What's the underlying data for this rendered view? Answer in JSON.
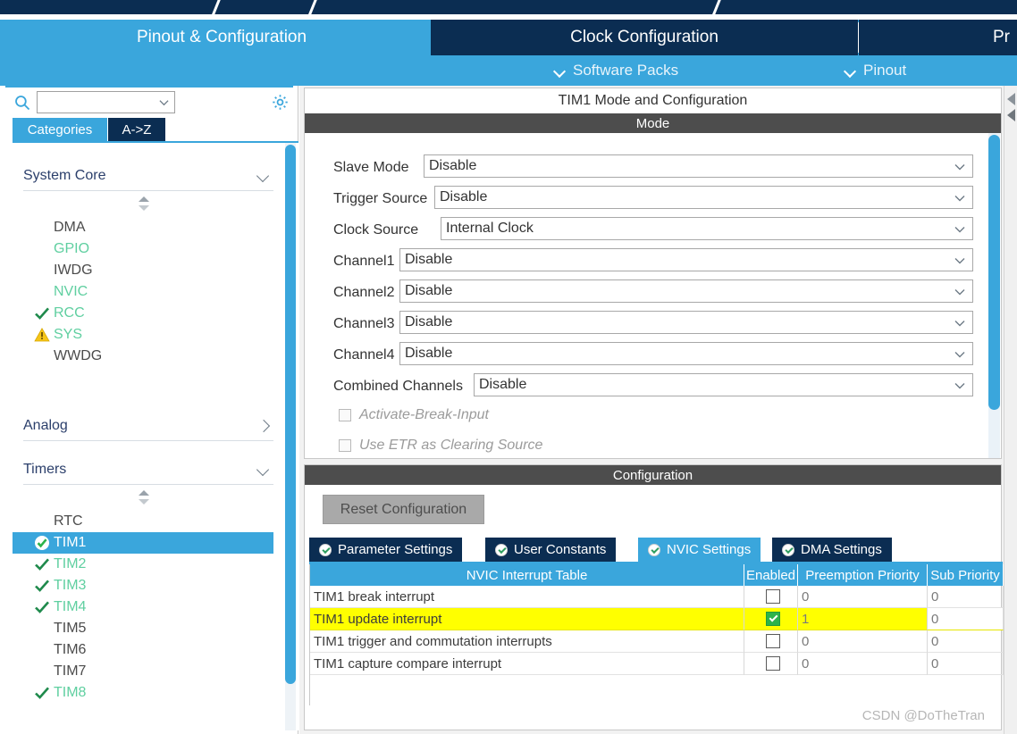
{
  "window": {
    "title_strip_color": "#0b2d52",
    "accent_color": "#3aa6dc",
    "navy_color": "#0b2d52"
  },
  "main_tabs": [
    {
      "label": "Pinout & Configuration",
      "active": true
    },
    {
      "label": "Clock Configuration",
      "active": false
    },
    {
      "label": "Pr",
      "active": false
    }
  ],
  "sub_tabs": [
    {
      "label": "Software Packs",
      "icon": "chevron-down-icon"
    },
    {
      "label": "Pinout",
      "icon": "chevron-down-icon"
    }
  ],
  "sidebar": {
    "search": {
      "value": "",
      "placeholder": "",
      "icon": "search-icon"
    },
    "settings_icon": "gear-icon",
    "filter_tabs": [
      {
        "label": "Categories",
        "selected": true
      },
      {
        "label": "A->Z",
        "selected": false
      }
    ],
    "groups": [
      {
        "name": "System Core",
        "expanded": true,
        "chevron": "chevron-down-icon",
        "items": [
          {
            "label": "DMA",
            "state": "none",
            "color": "#4b4b4b"
          },
          {
            "label": "GPIO",
            "state": "none",
            "color": "#5fcfa0"
          },
          {
            "label": "IWDG",
            "state": "none",
            "color": "#4b4b4b"
          },
          {
            "label": "NVIC",
            "state": "none",
            "color": "#5fcfa0"
          },
          {
            "label": "RCC",
            "state": "check",
            "color": "#5fcfa0"
          },
          {
            "label": "SYS",
            "state": "warning",
            "color": "#5fcfa0"
          },
          {
            "label": "WWDG",
            "state": "none",
            "color": "#4b4b4b"
          }
        ]
      },
      {
        "name": "Analog",
        "expanded": false,
        "chevron": "chevron-right-icon",
        "items": []
      },
      {
        "name": "Timers",
        "expanded": true,
        "chevron": "chevron-down-icon",
        "items": [
          {
            "label": "RTC",
            "state": "none",
            "color": "#4b4b4b",
            "selected": false
          },
          {
            "label": "TIM1",
            "state": "check-filled",
            "color": "#ffffff",
            "selected": true
          },
          {
            "label": "TIM2",
            "state": "check",
            "color": "#5fcfa0",
            "selected": false
          },
          {
            "label": "TIM3",
            "state": "check",
            "color": "#5fcfa0",
            "selected": false
          },
          {
            "label": "TIM4",
            "state": "check",
            "color": "#5fcfa0",
            "selected": false
          },
          {
            "label": "TIM5",
            "state": "none",
            "color": "#4b4b4b",
            "selected": false
          },
          {
            "label": "TIM6",
            "state": "none",
            "color": "#4b4b4b",
            "selected": false
          },
          {
            "label": "TIM7",
            "state": "none",
            "color": "#4b4b4b",
            "selected": false
          },
          {
            "label": "TIM8",
            "state": "check",
            "color": "#5fcfa0",
            "selected": false
          }
        ]
      }
    ]
  },
  "peripheral": {
    "title": "TIM1 Mode and Configuration",
    "mode_band": "Mode",
    "config_band": "Configuration",
    "mode_fields": [
      {
        "label": "Slave Mode",
        "value": "Disable"
      },
      {
        "label": "Trigger Source",
        "value": "Disable"
      },
      {
        "label": "Clock Source",
        "value": "Internal Clock"
      },
      {
        "label": "Channel1",
        "value": "Disable"
      },
      {
        "label": "Channel2",
        "value": "Disable"
      },
      {
        "label": "Channel3",
        "value": "Disable"
      },
      {
        "label": "Channel4",
        "value": "Disable"
      },
      {
        "label": "Combined Channels",
        "value": "Disable"
      }
    ],
    "mode_checkboxes": [
      {
        "label": "Activate-Break-Input",
        "checked": false,
        "disabled": true
      },
      {
        "label": "Use ETR as Clearing Source",
        "checked": false,
        "disabled": true
      }
    ],
    "reset_button": "Reset Configuration",
    "config_tabs": [
      {
        "label": "Parameter Settings",
        "active": false,
        "icon": "check-badge-icon"
      },
      {
        "label": "User Constants",
        "active": false,
        "icon": "check-badge-icon"
      },
      {
        "label": "NVIC Settings",
        "active": true,
        "icon": "check-badge-icon"
      },
      {
        "label": "DMA Settings",
        "active": false,
        "icon": "check-badge-icon"
      }
    ],
    "nvic_table": {
      "headers": [
        "NVIC Interrupt Table",
        "Enabled",
        "Preemption Priority",
        "Sub Priority"
      ],
      "rows": [
        {
          "name": "TIM1 break interrupt",
          "enabled": false,
          "preemption": "0",
          "sub": "0",
          "highlighted": false
        },
        {
          "name": "TIM1 update interrupt",
          "enabled": true,
          "preemption": "1",
          "sub": "0",
          "highlighted": true
        },
        {
          "name": "TIM1 trigger and commutation interrupts",
          "enabled": false,
          "preemption": "0",
          "sub": "0",
          "highlighted": false
        },
        {
          "name": "TIM1 capture compare interrupt",
          "enabled": false,
          "preemption": "0",
          "sub": "0",
          "highlighted": false
        }
      ]
    }
  },
  "watermark": "CSDN @DoTheTran"
}
